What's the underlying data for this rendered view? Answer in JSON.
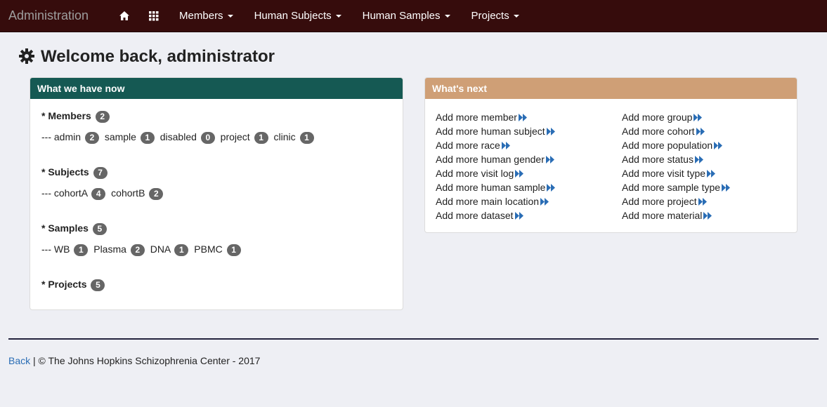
{
  "navbar": {
    "brand": "Administration",
    "home_icon": "home-icon",
    "apps_icon": "grid-icon",
    "menus": [
      "Members",
      "Human Subjects",
      "Human Samples",
      "Projects"
    ]
  },
  "page": {
    "icon": "gear-icon",
    "title": "Welcome back, administrator"
  },
  "summary": {
    "heading": "What we have now",
    "heading_color": "#155953",
    "members": {
      "label": "* Members",
      "count": "2",
      "prefix": "---",
      "items": [
        {
          "name": "admin",
          "count": "2"
        },
        {
          "name": "sample",
          "count": "1"
        },
        {
          "name": "disabled",
          "count": "0"
        },
        {
          "name": "project",
          "count": "1"
        },
        {
          "name": "clinic",
          "count": "1"
        }
      ]
    },
    "subjects": {
      "label": "* Subjects",
      "count": "7",
      "prefix": "---",
      "items": [
        {
          "name": "cohortA",
          "count": "4"
        },
        {
          "name": "cohortB",
          "count": "2"
        }
      ]
    },
    "samples": {
      "label": "* Samples",
      "count": "5",
      "prefix": "---",
      "items": [
        {
          "name": "WB",
          "count": "1"
        },
        {
          "name": "Plasma",
          "count": "2"
        },
        {
          "name": "DNA",
          "count": "1"
        },
        {
          "name": "PBMC",
          "count": "1"
        }
      ]
    },
    "projects": {
      "label": "* Projects",
      "count": "5"
    }
  },
  "next": {
    "heading": "What's next",
    "heading_color": "#cf9f76",
    "left_links": [
      "Add more member",
      "Add more human subject",
      "Add more race",
      "Add more human gender",
      "Add more visit log",
      "Add more human sample",
      "Add more main location",
      "Add more dataset"
    ],
    "right_links": [
      "Add more group",
      "Add more cohort",
      "Add more population",
      "Add more status",
      "Add more visit type",
      "Add more sample type",
      "Add more project",
      "Add more material"
    ],
    "arrow_icon": "double-arrow-right-icon",
    "arrow_color": "#2a6db5"
  },
  "footer": {
    "back_label": "Back",
    "text": "| © The Johns Hopkins Schizophrenia Center - 2017"
  }
}
